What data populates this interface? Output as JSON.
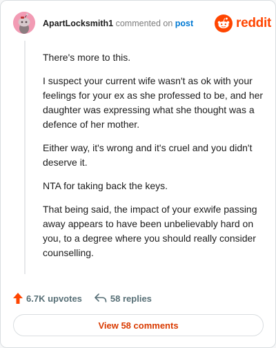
{
  "header": {
    "author": "ApartLocksmith1",
    "action_text": "commented on",
    "target_link": "post",
    "brand": "reddit"
  },
  "comment": {
    "paragraphs": [
      "There's more to this.",
      "I suspect your current wife wasn't as ok with your feelings for your ex as she professed to be, and her daughter was expressing what she thought was a defence of her mother.",
      "Either way, it's wrong and it's cruel and you didn't deserve it.",
      "NTA for taking back the keys.",
      "That being said, the impact of your exwife passing away appears to have been unbelievably hard on you, to a degree where you should really consider counselling."
    ]
  },
  "actions": {
    "upvotes": "6.7K upvotes",
    "replies": "58 replies"
  },
  "footer": {
    "view_comments": "View 58 comments"
  },
  "icons": {
    "avatar": "snoo-avatar-icon",
    "brand": "reddit-logo-icon",
    "upvote": "upvote-arrow-icon",
    "reply": "reply-arrow-icon"
  },
  "colors": {
    "brand": "#ff4500",
    "link": "#0079d3",
    "upvote": "#ff4500",
    "view_button_text": "#d93a00"
  }
}
